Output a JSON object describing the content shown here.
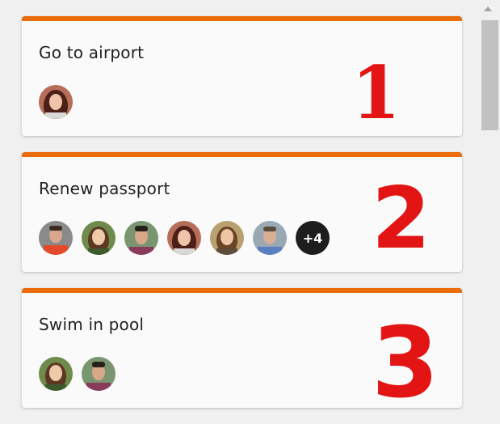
{
  "cards": [
    {
      "title": "Go to airport",
      "annotation": "1"
    },
    {
      "title": "Renew passport",
      "annotation": "2",
      "more_label": "+4"
    },
    {
      "title": "Swim in pool",
      "annotation": "3"
    }
  ],
  "colors": {
    "accent": "#ea6c0a",
    "annotation": "#e31414",
    "card_bg": "#fafafa",
    "page_bg": "#f0f0f0"
  }
}
